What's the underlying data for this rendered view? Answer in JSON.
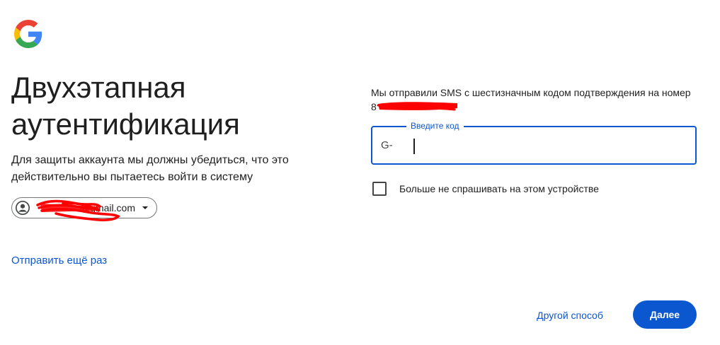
{
  "colors": {
    "accent": "#0b57d0",
    "text": "#1f1f1f",
    "redaction": "#ff0000",
    "background": "#ffffff"
  },
  "header": {
    "logo_icon": "google-g-logo"
  },
  "left": {
    "title": "Двухэтапная аутентификация",
    "subtitle": "Для защиты аккаунта мы должны убедиться, что это действительно вы пытаетесь войти в систему",
    "account": {
      "avatar_icon": "account-circle-icon",
      "email_visible": "@gmail.com",
      "caret_icon": "caret-down-icon"
    },
    "resend_label": "Отправить ещё раз"
  },
  "right": {
    "sms_text": "Мы отправили SMS с шестизначным кодом подтверждения на номер",
    "phone_prefix": "8",
    "code_field": {
      "label": "Введите код",
      "prefix": "G-",
      "value": ""
    },
    "remember_label": "Больше не спрашивать на этом устройстве",
    "remember_checked": false
  },
  "footer": {
    "other_way_label": "Другой способ",
    "next_label": "Далее"
  }
}
